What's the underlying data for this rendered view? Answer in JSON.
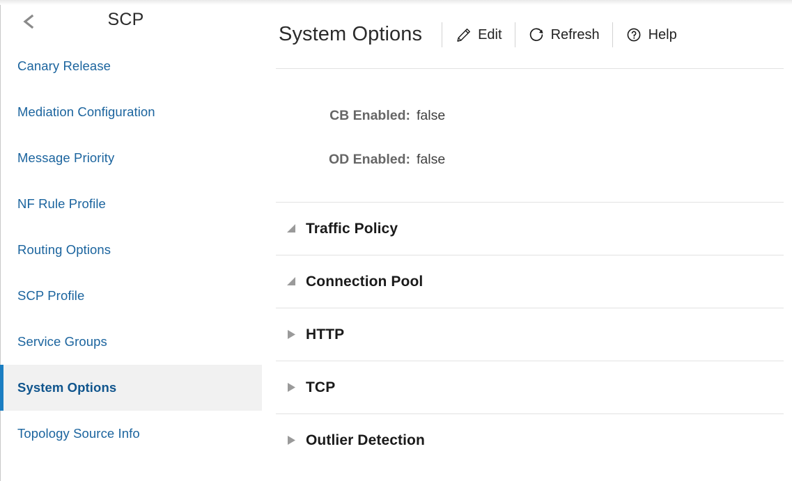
{
  "sidebar": {
    "back_icon": "chevron-left-icon",
    "title": "SCP",
    "items": [
      {
        "label": "Canary Release",
        "selected": false
      },
      {
        "label": "Mediation Configuration",
        "selected": false
      },
      {
        "label": "Message Priority",
        "selected": false
      },
      {
        "label": "NF Rule Profile",
        "selected": false
      },
      {
        "label": "Routing Options",
        "selected": false
      },
      {
        "label": "SCP Profile",
        "selected": false
      },
      {
        "label": "Service Groups",
        "selected": false
      },
      {
        "label": "System Options",
        "selected": true
      },
      {
        "label": "Topology Source Info",
        "selected": false
      }
    ],
    "accent_color": "#1b7ec2",
    "link_color": "#1b649e",
    "selected_bg": "#f1f1f1"
  },
  "main": {
    "title": "System Options",
    "toolbar": [
      {
        "label": "Edit",
        "icon": "pencil-icon"
      },
      {
        "label": "Refresh",
        "icon": "refresh-icon"
      },
      {
        "label": "Help",
        "icon": "help-circle-icon"
      }
    ],
    "fields": [
      {
        "label": "CB Enabled:",
        "value": "false"
      },
      {
        "label": "OD Enabled:",
        "value": "false"
      }
    ],
    "sections": [
      {
        "title": "Traffic Policy",
        "expanded": true
      },
      {
        "title": "Connection Pool",
        "expanded": true
      },
      {
        "title": "HTTP",
        "expanded": false
      },
      {
        "title": "TCP",
        "expanded": false
      },
      {
        "title": "Outlier Detection",
        "expanded": false
      }
    ]
  }
}
